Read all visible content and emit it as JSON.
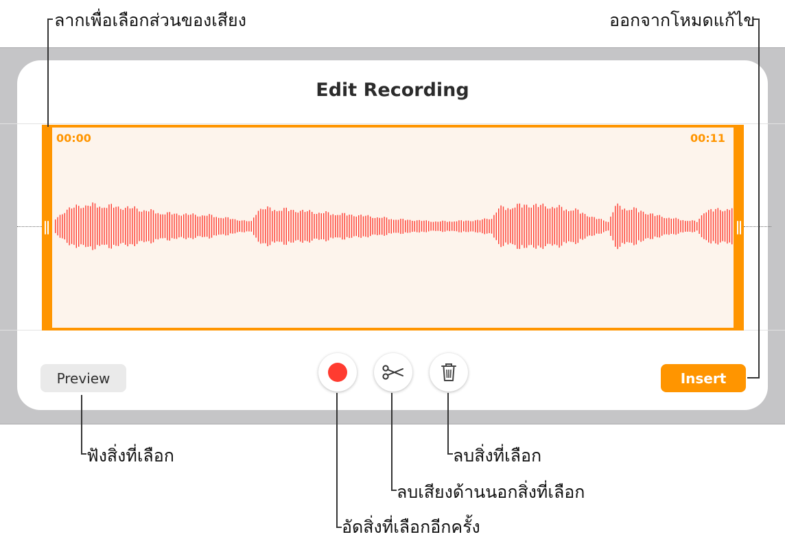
{
  "dialog": {
    "title": "Edit Recording",
    "start_time": "00:00",
    "end_time": "00:11",
    "preview_label": "Preview",
    "insert_label": "Insert"
  },
  "icons": {
    "record": "record-icon",
    "trim": "scissors-icon",
    "delete": "trash-icon"
  },
  "colors": {
    "accent": "#ff9500",
    "waveform": "#ff3b30",
    "selection_fill": "#fdf4ec",
    "record": "#ff3b30"
  },
  "callouts": {
    "drag_select": "ลากเพื่อเลือกส่วนของเสียง",
    "exit_edit": "ออกจากโหมดแก้ไข",
    "listen_selection": "ฟังสิ่งที่เลือก",
    "delete_selection": "ลบสิ่งที่เลือก",
    "trim_outside": "ลบเสียงด้านนอกสิ่งที่เลือก",
    "rerecord_selection": "อัดสิ่งที่เลือกอีกครั้ง"
  }
}
